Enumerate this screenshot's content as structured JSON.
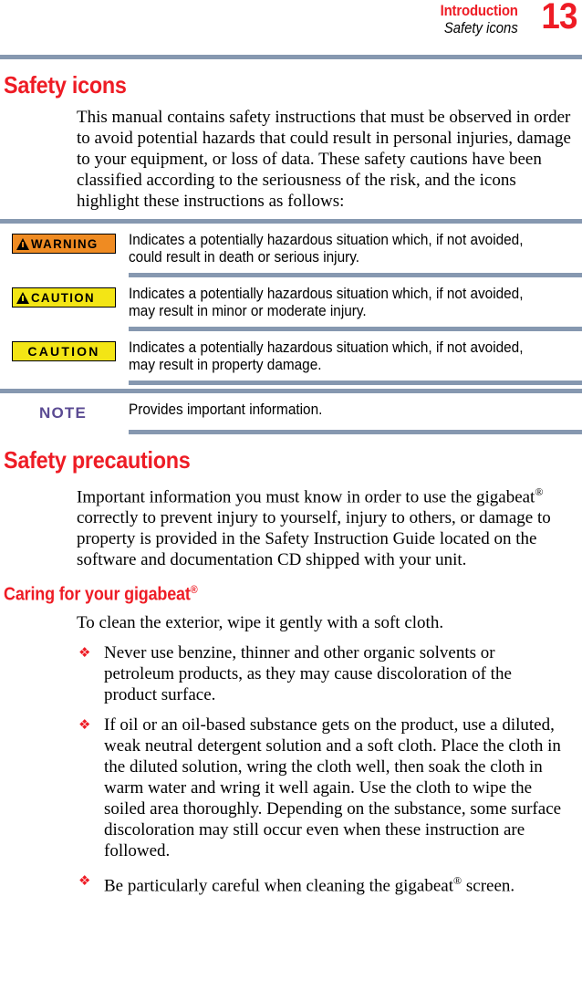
{
  "header": {
    "chapter": "Introduction",
    "section": "Safety icons",
    "page_number": "13",
    "chapter_color": "#ee1c25",
    "rule_color": "#8698b0"
  },
  "sections": [
    {
      "title": "Safety icons",
      "intro": "This manual contains safety instructions that must be observed in order to avoid potential hazards that could result in personal injuries, damage to your equipment, or loss of data. These safety cautions have been classified according to the seriousness of the risk, and the icons highlight these instructions as follows:"
    }
  ],
  "callouts": [
    {
      "badge_label": "WARNING",
      "badge_style": "warning",
      "badge_color": "#ef8b22",
      "has_triangle": true,
      "description": "Indicates a potentially hazardous situation which, if not avoided, could result in death or serious injury."
    },
    {
      "badge_label": "CAUTION",
      "badge_style": "caution",
      "badge_color": "#f3e515",
      "has_triangle": true,
      "description": "Indicates a potentially hazardous situation which, if not avoided, may result in minor or moderate injury."
    },
    {
      "badge_label": "CAUTION",
      "badge_style": "caution-plain",
      "badge_color": "#f3e515",
      "has_triangle": false,
      "description": "Indicates a potentially hazardous situation which, if not avoided, may result in property damage."
    },
    {
      "badge_label": "NOTE",
      "badge_style": "note",
      "badge_color": "#5b4b93",
      "has_triangle": false,
      "description": "Provides important information."
    }
  ],
  "safety_precautions": {
    "title": "Safety precautions",
    "body_part1": "Important information you must know in order to use the gigabeat",
    "reg_mark": "®",
    "body_part2": " correctly to prevent injury to yourself, injury to others, or damage to property is provided in the Safety Instruction Guide located on the software and documentation CD shipped with your unit."
  },
  "caring": {
    "title_part1": "Caring for your gigabeat",
    "reg_mark": "®",
    "intro": "To clean the exterior, wipe it gently with a soft cloth.",
    "bullet_glyph": "❖",
    "bullets": [
      {
        "text": "Never use benzine, thinner and other organic solvents or petroleum products, as they may cause discoloration of the product surface.",
        "has_reg": false
      },
      {
        "text": "If oil or an oil-based substance gets on the product, use a diluted, weak neutral detergent solution and a soft cloth. Place the cloth in the diluted solution, wring the cloth well, then soak the cloth in warm water and wring it well again. Use the cloth to wipe the soiled area thoroughly. Depending on the substance, some surface discoloration may still occur even when these instruction are followed.",
        "has_reg": false
      },
      {
        "text_before": "Be particularly careful when cleaning the gigabeat",
        "reg": "®",
        "text_after": " screen.",
        "has_reg": true
      }
    ]
  }
}
